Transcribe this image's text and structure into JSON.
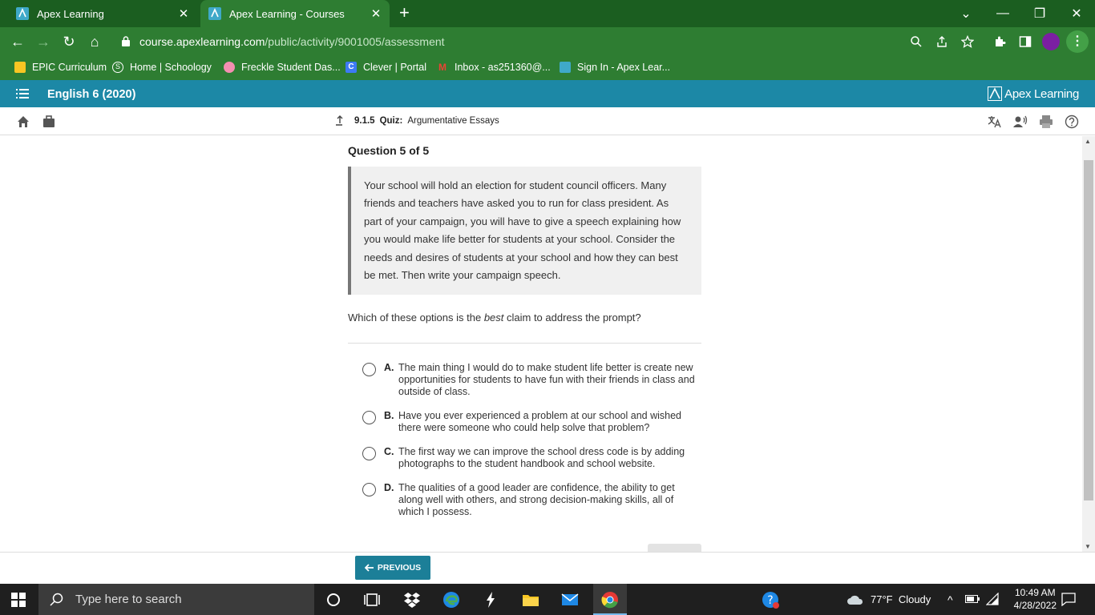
{
  "browser": {
    "tabs": [
      {
        "title": "Apex Learning",
        "active": false
      },
      {
        "title": "Apex Learning - Courses",
        "active": true
      }
    ],
    "url_host": "course.apexlearning.com",
    "url_path": "/public/activity/9001005/assessment",
    "bookmarks": [
      {
        "label": "EPIC Curriculum",
        "icon": "bookmark-icon",
        "color": "#f9c623"
      },
      {
        "label": "Home | Schoology",
        "icon": "schoology-icon",
        "color": "#ffffff"
      },
      {
        "label": "Freckle Student Das...",
        "icon": "freckle-icon",
        "color": "#f48fb1"
      },
      {
        "label": "Clever | Portal",
        "icon": "clever-icon",
        "color": "#3d7af5"
      },
      {
        "label": "Inbox - as251360@...",
        "icon": "gmail-icon",
        "color": "#ea4335"
      },
      {
        "label": "Sign In - Apex Lear...",
        "icon": "apex-icon",
        "color": "#3fa9c9"
      }
    ]
  },
  "app": {
    "course": "English 6 (2020)",
    "brand": "Apex Learning",
    "crumb_number": "9.1.5",
    "crumb_type": "Quiz:",
    "crumb_title": "Argumentative Essays"
  },
  "quiz": {
    "heading": "Question 5 of 5",
    "prompt": "Your school will hold an election for student council officers. Many friends and teachers have asked you to run for class president. As part of your campaign, you will have to give a speech explaining how you would make life better for students at your school. Consider the needs and desires of students at your school and how they can best be met. Then write your campaign speech.",
    "question_before": "Which of these options is the ",
    "question_emph": "best",
    "question_after": " claim to address the prompt?",
    "options": [
      {
        "letter": "A.",
        "text": "The main thing I would do to make student life better is create new opportunities for students to have fun with their friends in class and outside of class."
      },
      {
        "letter": "B.",
        "text": "Have you ever experienced a problem at our school and wished there were someone who could help solve that problem?"
      },
      {
        "letter": "C.",
        "text": "The first way we can improve the school dress code is by adding photographs to the student handbook and school website."
      },
      {
        "letter": "D.",
        "text": "The qualities of a good leader are confidence, the ability to get along well with others, and strong decision-making skills, all of which I possess."
      }
    ],
    "previous_label": "PREVIOUS"
  },
  "taskbar": {
    "search_placeholder": "Type here to search",
    "weather": "77°F  Cloudy",
    "time": "10:49 AM",
    "date": "4/28/2022"
  },
  "colors": {
    "chrome_dark": "#1b5e20",
    "chrome": "#2e7d32",
    "app_accent": "#1c88a6",
    "button": "#1c7f98"
  }
}
